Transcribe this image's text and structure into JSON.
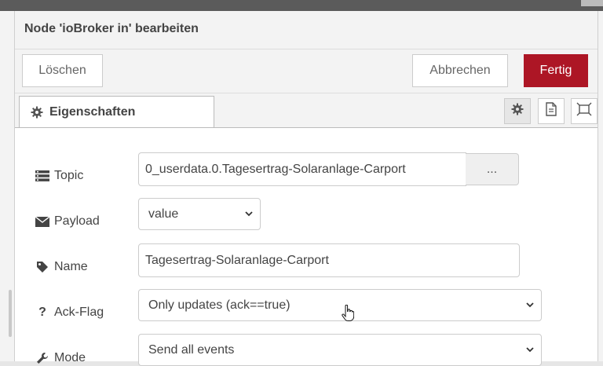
{
  "dialog": {
    "title": "Node 'ioBroker in' bearbeiten",
    "buttons": {
      "delete": "Löschen",
      "cancel": "Abbrechen",
      "done": "Fertig"
    },
    "tabs": [
      {
        "label": "Eigenschaften",
        "icon": "gear-icon"
      }
    ],
    "tab_icons": [
      "gear-icon",
      "description-icon",
      "appearance-icon"
    ]
  },
  "form": {
    "topic": {
      "label": "Topic",
      "value": "0_userdata.0.Tagesertrag-Solaranlage-Carport",
      "browse_label": "..."
    },
    "payload": {
      "label": "Payload",
      "value": "value"
    },
    "name": {
      "label": "Name",
      "value": "Tagesertrag-Solaranlage-Carport"
    },
    "ack_flag": {
      "label": "Ack-Flag",
      "icon_text": "?",
      "value": "Only updates (ack==true)"
    },
    "mode": {
      "label": "Mode",
      "value": "Send all events"
    }
  },
  "colors": {
    "primary_button": "#ad1625",
    "header_bg": "#f3f3f3"
  }
}
